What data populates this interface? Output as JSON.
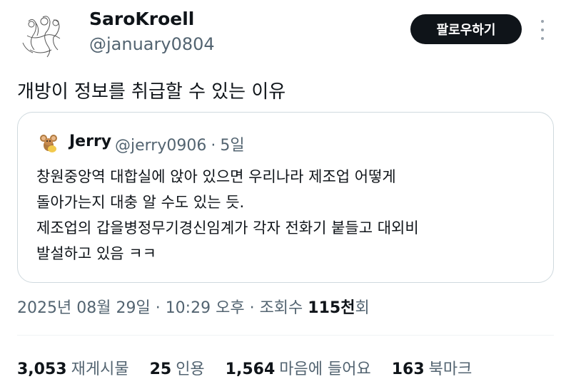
{
  "profile": {
    "name": "SaroKroell",
    "handle": "@january0804",
    "follow_label": "팔로우하기"
  },
  "tweet": {
    "text": "개방이 정보를 취급할 수 있는 이유"
  },
  "quote": {
    "name": "Jerry",
    "handle": "@jerry0906",
    "separator": "·",
    "age": "5일",
    "lines": [
      "창원중앙역 대합실에 앉아 있으면 우리나라 제조업 어떻게",
      "돌아가는지 대충 알 수도 있는 듯.",
      "제조업의 갑을병정무기경신임계가 각자 전화기 붙들고 대외비",
      "발설하고 있음 ㅋㅋ"
    ]
  },
  "meta": {
    "date": "2025년 08월 29일",
    "sep1": "·",
    "time": "10:29 오후",
    "sep2": "·",
    "views_label": "조회수",
    "views_num": "115천",
    "views_suffix": "회"
  },
  "stats": [
    {
      "num": "3,053",
      "label": "재게시물"
    },
    {
      "num": "25",
      "label": "인용"
    },
    {
      "num": "1,564",
      "label": "마음에 들어요"
    },
    {
      "num": "163",
      "label": "북마크"
    }
  ]
}
